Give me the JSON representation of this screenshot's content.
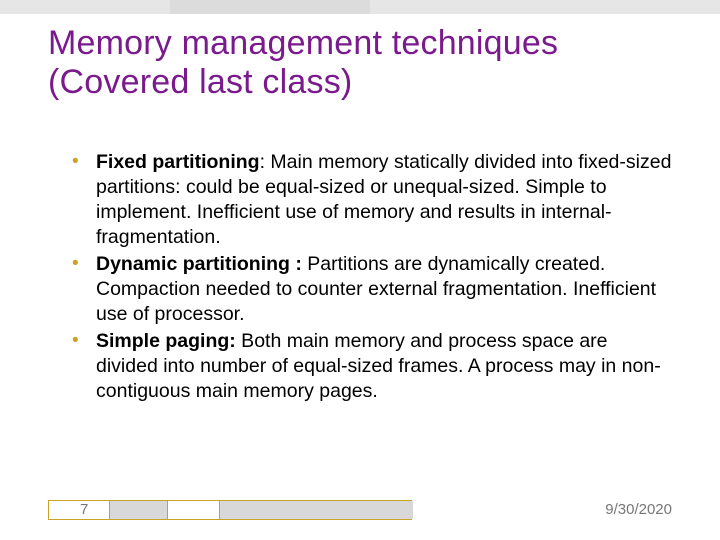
{
  "title": "Memory management techniques (Covered last class)",
  "bullets": [
    {
      "lead": "Fixed partitioning",
      "rest": ": Main memory statically divided into fixed-sized partitions: could be equal-sized or unequal-sized. Simple to implement. Inefficient use of memory and results in internal-fragmentation."
    },
    {
      "lead": "Dynamic partitioning :",
      "rest": " Partitions are dynamically created. Compaction needed to counter external fragmentation. Inefficient use of processor."
    },
    {
      "lead": "Simple paging:",
      "rest": " Both main memory and process space are divided into number of equal-sized frames. A process may in non-contiguous main memory pages."
    }
  ],
  "footer": {
    "page": "7",
    "date": "9/30/2020"
  }
}
